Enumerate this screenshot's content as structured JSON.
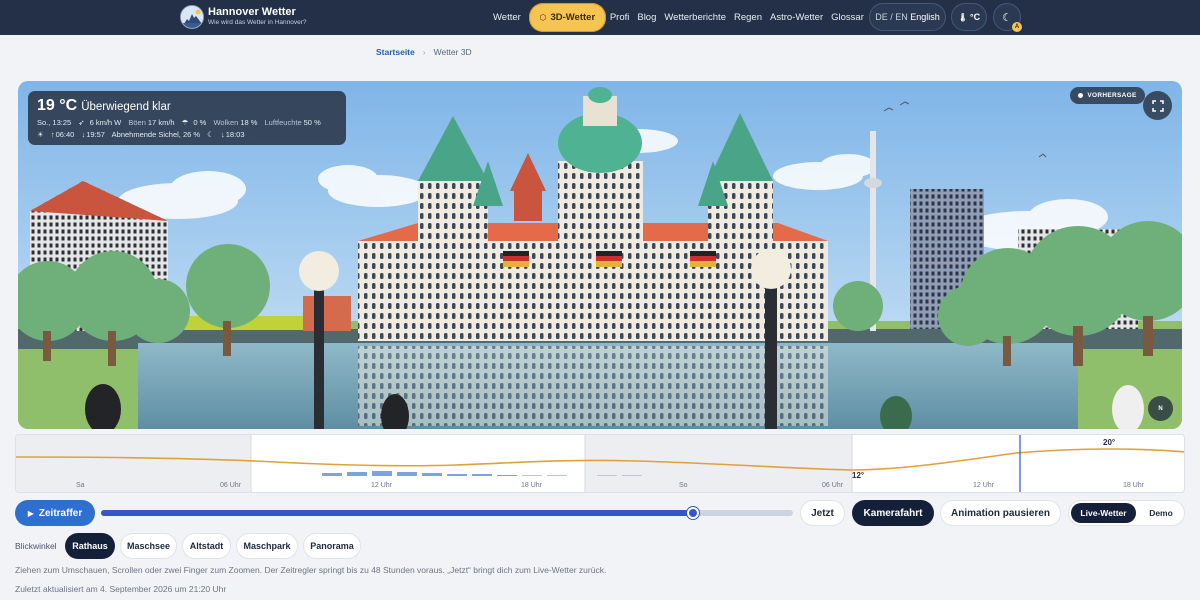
{
  "header": {
    "brand_title": "Hannover Wetter",
    "brand_subtitle": "Wie wird das Wetter in Hannover?",
    "nav": [
      "Wetter",
      "3D-Wetter",
      "Profi",
      "Blog",
      "Wetterberichte",
      "Regen",
      "Astro-Wetter",
      "Glossar"
    ],
    "active_nav": "3D-Wetter",
    "lang_short": "DE / EN",
    "lang_name": "English",
    "unit": "°C",
    "theme_badge": "A"
  },
  "breadcrumb": {
    "home": "Startseite",
    "current": "Wetter 3D"
  },
  "weather": {
    "temp": "19 °C",
    "condition": "Überwiegend klar",
    "time": "So., 13:25",
    "wind": "6 km/h W",
    "gusts_label": "Böen",
    "gusts": "17 km/h",
    "rain": "0 %",
    "clouds_label": "Wolken",
    "clouds": "18 %",
    "humidity_label": "Luftfeuchte",
    "humidity": "50 %",
    "sunrise": "06:40",
    "sunset": "19:57",
    "moon": "Abnehmende Sichel, 26 %",
    "moonset": "18:03"
  },
  "scene": {
    "badge": "VORHERSAGE",
    "compass": "N"
  },
  "timeline": {
    "labels": [
      "Sa",
      "06 Uhr",
      "12 Uhr",
      "18 Uhr",
      "So",
      "06 Uhr",
      "12 Uhr",
      "18 Uhr"
    ],
    "min_temp": "12°",
    "max_temp": "20°"
  },
  "controls": {
    "play": "Zeitraffer",
    "slider_progress": 0.855,
    "now": "Jetzt",
    "camera": "Kamerafahrt",
    "pause": "Animation pausieren",
    "mode_live": "Live-Wetter",
    "mode_demo": "Demo"
  },
  "views": {
    "label": "Blickwinkel",
    "items": [
      "Rathaus",
      "Maschsee",
      "Altstadt",
      "Maschpark",
      "Panorama"
    ],
    "active": "Rathaus"
  },
  "hint": "Ziehen zum Umschauen, Scrollen oder zwei Finger zum Zoomen. Der Zeitregler springt bis zu 48 Stunden voraus. „Jetzt“ bringt dich zum Live-Wetter zurück.",
  "updated": "Zuletzt aktualisiert am 4. September 2026 um 21:20 Uhr",
  "colors": {
    "header_bg": "#233047",
    "accent_pill": "#f6c453",
    "slider": "#3556c6",
    "dark_button": "#14203a",
    "temperature_line": "#e0a13a",
    "rain_bars": "#7da2e0"
  }
}
